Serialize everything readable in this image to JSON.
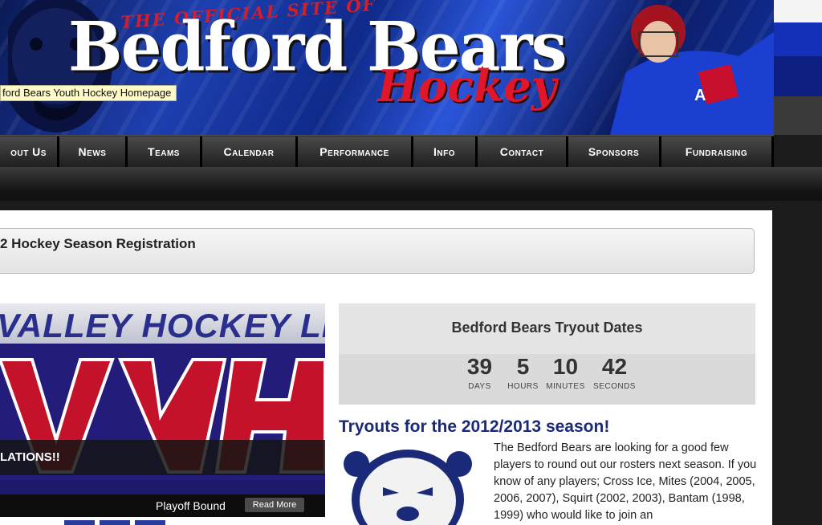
{
  "header": {
    "tagline": "The Official Site of",
    "title": "Bedford Bears",
    "subtitle": "Hockey",
    "tooltip": "ford Bears Youth Hockey Homepage"
  },
  "nav": {
    "items": [
      {
        "label": "out Us"
      },
      {
        "label": "News"
      },
      {
        "label": "Teams"
      },
      {
        "label": "Calendar"
      },
      {
        "label": "Performance"
      },
      {
        "label": "Info"
      },
      {
        "label": "Contact"
      },
      {
        "label": "Sponsors"
      },
      {
        "label": "Fundraising"
      }
    ]
  },
  "registration": {
    "title": "2 Hockey Season Registration"
  },
  "slider": {
    "banner_text": "VALLEY HOCKEY LEA",
    "caption": "LATIONS!!",
    "bottom_text": "Playoff Bound",
    "read_more": "Read More"
  },
  "tryout": {
    "title": "Bedford Bears Tryout Dates",
    "countdown": [
      {
        "value": "39",
        "label": "DAYS"
      },
      {
        "value": "5",
        "label": "HOURS"
      },
      {
        "value": "10",
        "label": "MINUTES"
      },
      {
        "value": "42",
        "label": "SECONDS"
      }
    ]
  },
  "news": {
    "title": "Tryouts for the 2012/2013 season!",
    "body": "The Bedford Bears are looking for a good few players to round out our rosters next season. If you know of any players; Cross Ice, Mites (2004, 2005, 2006, 2007), Squirt (2002, 2003), Bantam (1998, 1999) who would like to join an"
  },
  "colors": {
    "banner_blue": "#1d3fb0",
    "title_red": "#e0162a",
    "news_title": "#1b2a78",
    "nav_bg": "#2b2b2b"
  }
}
